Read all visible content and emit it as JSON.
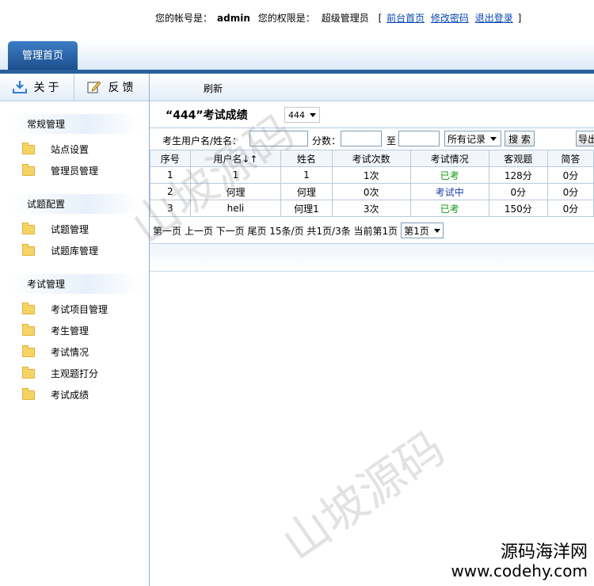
{
  "header": {
    "account_label": "您的帐号是：",
    "account_value": "admin",
    "perm_label": "您的权限是：",
    "perm_value": "超级管理员",
    "bracket_open": "[",
    "bracket_close": "]",
    "links": [
      "前台首页",
      "修改密码",
      "退出登录"
    ]
  },
  "tabs": {
    "active": "管理首页"
  },
  "sidebar": {
    "buttons": {
      "about": "关于",
      "feedback": "反馈"
    },
    "groups": [
      {
        "title": "常规管理",
        "items": [
          "站点设置",
          "管理员管理"
        ]
      },
      {
        "title": "试题配置",
        "items": [
          "试题管理",
          "试题库管理"
        ]
      },
      {
        "title": "考试管理",
        "items": [
          "考试项目管理",
          "考生管理",
          "考试情况",
          "主观题打分",
          "考试成绩"
        ]
      }
    ]
  },
  "toolbar": {
    "refresh": "刷新"
  },
  "main": {
    "title": "“444”考试成绩",
    "exam_select": "444",
    "filter": {
      "user_label": "考生用户名/姓名：",
      "score_label": "分数：",
      "to_label": "至",
      "records_select": "所有记录",
      "search_button": "搜 索",
      "export_button": "导出"
    },
    "table": {
      "columns": [
        "序号",
        "用户名↓↑",
        "姓名",
        "考试次数",
        "考试情况",
        "客观题",
        "简答"
      ],
      "rows": [
        [
          "1",
          "1",
          "1",
          "1次",
          "已考",
          "128分",
          "0分"
        ],
        [
          "2",
          "何理",
          "何理",
          "0次",
          "考试中",
          "0分",
          "0分"
        ],
        [
          "3",
          "heli",
          "何理1",
          "3次",
          "已考",
          "150分",
          "0分"
        ]
      ]
    },
    "pager": {
      "text": "第一页 上一页 下一页 尾页 15条/页 共1页/3条 当前第1页",
      "page_select": "第1页"
    }
  },
  "watermarks": {
    "text": "山坡源码"
  },
  "brand": {
    "cn": "源码海洋网",
    "url": "www.codehy.com"
  }
}
